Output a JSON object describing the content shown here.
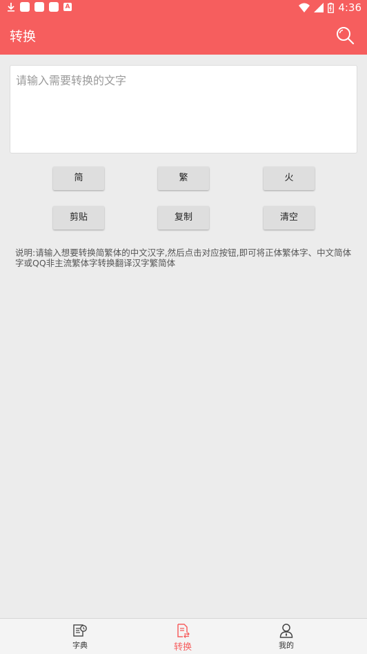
{
  "status_bar": {
    "time": "4:36",
    "left_icons": [
      "download-icon",
      "notification-icon",
      "notification-icon",
      "notification-icon",
      "app-icon"
    ],
    "right_icons": [
      "wifi-icon",
      "signal-icon",
      "battery-icon"
    ],
    "app_icon_glyph": "A"
  },
  "app_bar": {
    "title": "转换",
    "search_icon": "search-icon",
    "color": "#f65e5e"
  },
  "input": {
    "placeholder": "请输入需要转换的文字",
    "value": ""
  },
  "buttons": {
    "simplified": "简",
    "traditional": "繁",
    "mars": "火",
    "paste": "剪贴",
    "copy": "复制",
    "clear": "清空"
  },
  "description": "说明:请输入想要转换简繁体的中文汉字,然后点击对应按钮,即可将正体繁体字、中文简体字或QQ非主流繁体字转换翻译汉字繁简体",
  "bottom_nav": {
    "items": [
      {
        "label": "字典",
        "icon": "dictionary-icon",
        "active": false
      },
      {
        "label": "转换",
        "icon": "convert-icon",
        "active": true
      },
      {
        "label": "我的",
        "icon": "profile-icon",
        "active": false
      }
    ],
    "active_color": "#f65e5e"
  }
}
